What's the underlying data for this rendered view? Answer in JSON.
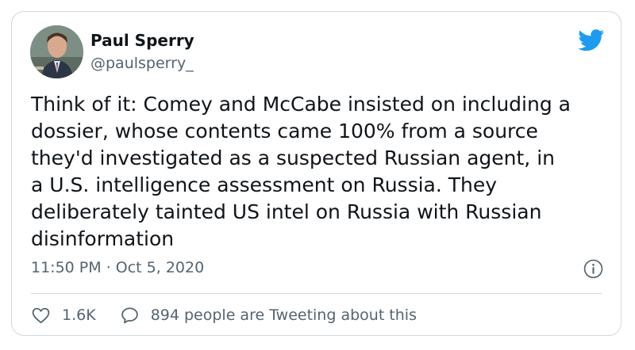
{
  "author": {
    "name": "Paul Sperry",
    "handle": "@paulsperry_"
  },
  "tweet": {
    "text": "Think of it: Comey and McCabe insisted on including a\ndossier, whose contents came 100% from a source\nthey'd investigated as a suspected Russian agent, in\na U.S. intelligence assessment on Russia. They\ndeliberately tainted US intel on Russia with Russian\ndisinformation",
    "time": "11:50 PM",
    "separator": " · ",
    "date": "Oct 5, 2020"
  },
  "actions": {
    "likes": "1.6K",
    "tweeting": "894 people are Tweeting about this"
  },
  "icons": {
    "brand": "twitter-bird-icon",
    "info": "info-icon",
    "like": "heart-icon",
    "reply": "speech-bubble-icon"
  },
  "colors": {
    "brand": "#1d9bf0",
    "text": "#0f1419",
    "muted": "#536471",
    "border": "#cfd9de"
  }
}
